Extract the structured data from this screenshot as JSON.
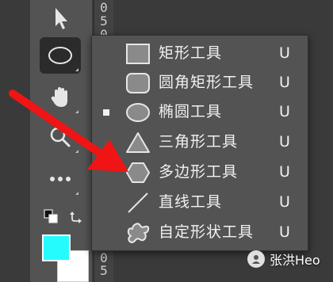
{
  "ruler": {
    "labels": [
      "0",
      "5",
      "0",
      "0",
      "5",
      "0",
      "0",
      "5"
    ]
  },
  "toolbar": {
    "tools": [
      {
        "name": "move-tool",
        "icon": "arrow-pointer-icon"
      },
      {
        "name": "ellipse-tool",
        "icon": "ellipse-icon",
        "active": true
      },
      {
        "name": "hand-tool",
        "icon": "hand-icon"
      },
      {
        "name": "zoom-tool",
        "icon": "magnifier-icon"
      },
      {
        "name": "more-tools",
        "icon": "ellipsis-icon"
      }
    ],
    "foreground_color": "#25fbfd",
    "background_color": "#ffffff"
  },
  "menu": {
    "items": [
      {
        "label": "矩形工具",
        "shortcut": "U",
        "icon": "rectangle-icon",
        "selected": false
      },
      {
        "label": "圆角矩形工具",
        "shortcut": "U",
        "icon": "rounded-rectangle-icon",
        "selected": false
      },
      {
        "label": "椭圆工具",
        "shortcut": "U",
        "icon": "ellipse-icon",
        "selected": true
      },
      {
        "label": "三角形工具",
        "shortcut": "U",
        "icon": "triangle-icon",
        "selected": false
      },
      {
        "label": "多边形工具",
        "shortcut": "U",
        "icon": "polygon-icon",
        "selected": false
      },
      {
        "label": "直线工具",
        "shortcut": "U",
        "icon": "line-icon",
        "selected": false
      },
      {
        "label": "自定形状工具",
        "shortcut": "U",
        "icon": "custom-shape-icon",
        "selected": false
      }
    ]
  },
  "annotation": {
    "arrow_color": "#f01414"
  },
  "watermark": {
    "text": "张洪Heo"
  }
}
